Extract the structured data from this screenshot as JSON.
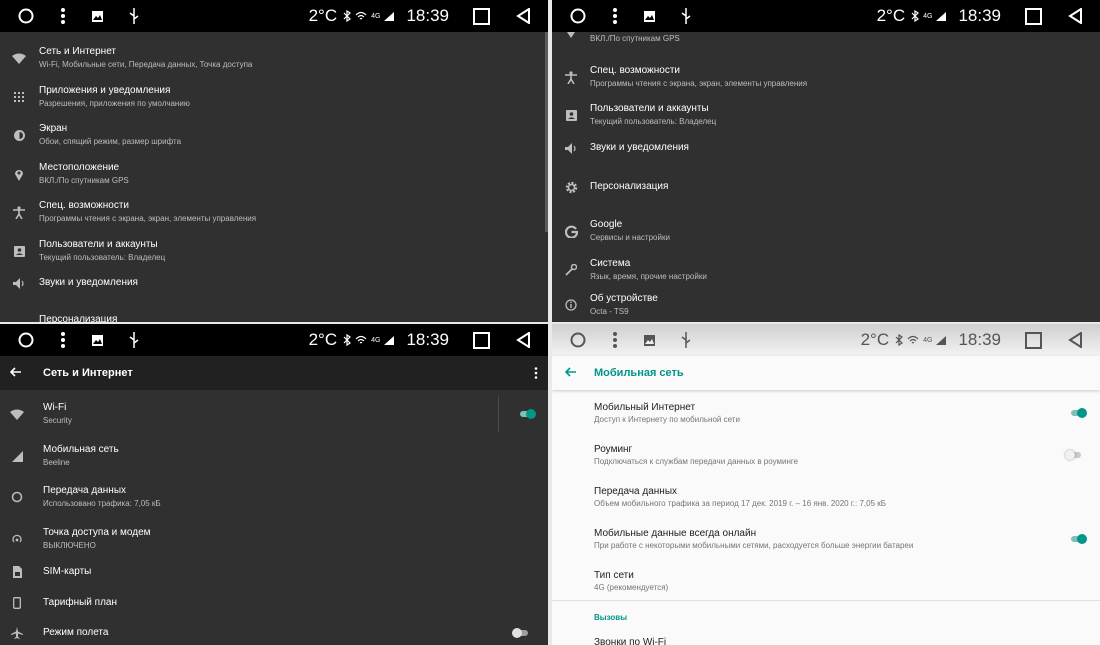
{
  "statusbar": {
    "temp": "2°C",
    "time": "18:39",
    "net": "4G"
  },
  "panel1": {
    "items": [
      {
        "title": "Сеть и Интернет",
        "subtitle": "Wi-Fi, Мобильные сети, Передача данных, Точка доступа"
      },
      {
        "title": "Приложения и уведомления",
        "subtitle": "Разрешения, приложения по умолчанию"
      },
      {
        "title": "Экран",
        "subtitle": "Обои, спящий режим, размер шрифта"
      },
      {
        "title": "Местоположение",
        "subtitle": "ВКЛ./По спутникам GPS"
      },
      {
        "title": "Спец. возможности",
        "subtitle": "Программы чтения с экрана, экран, элементы управления"
      },
      {
        "title": "Пользователи и аккаунты",
        "subtitle": "Текущий пользователь: Владелец"
      },
      {
        "title": "Звуки и уведомления",
        "subtitle": ""
      },
      {
        "title": "Персонализация",
        "subtitle": ""
      }
    ]
  },
  "panel2": {
    "items": [
      {
        "title": "",
        "subtitle": "ВКЛ./По спутникам GPS"
      },
      {
        "title": "Спец. возможности",
        "subtitle": "Программы чтения с экрана, экран, элементы управления"
      },
      {
        "title": "Пользователи и аккаунты",
        "subtitle": "Текущий пользователь: Владелец"
      },
      {
        "title": "Звуки и уведомления",
        "subtitle": ""
      },
      {
        "title": "Персонализация",
        "subtitle": ""
      },
      {
        "title": "Google",
        "subtitle": "Сервисы и настройки"
      },
      {
        "title": "Система",
        "subtitle": "Язык, время, прочие настройки"
      },
      {
        "title": "Об устройстве",
        "subtitle": "Octa - TS9"
      }
    ]
  },
  "panel3": {
    "title": "Сеть и Интернет",
    "items": [
      {
        "title": "Wi-Fi",
        "subtitle": "Security",
        "toggle": true
      },
      {
        "title": "Мобильная сеть",
        "subtitle": "Beeline"
      },
      {
        "title": "Передача данных",
        "subtitle": "Использовано трафика: 7,05 кБ"
      },
      {
        "title": "Точка доступа и модем",
        "subtitle": "ВЫКЛЮЧЕНО"
      },
      {
        "title": "SIM-карты",
        "subtitle": ""
      },
      {
        "title": "Тарифный план",
        "subtitle": ""
      },
      {
        "title": "Режим полета",
        "subtitle": "",
        "toggle": false
      }
    ]
  },
  "panel4": {
    "title": "Мобильная сеть",
    "items": [
      {
        "title": "Мобильный Интернет",
        "subtitle": "Доступ к Интернету по мобильной сети",
        "toggle": true
      },
      {
        "title": "Роуминг",
        "subtitle": "Подключаться к службам передачи данных в роуминге",
        "toggle": false
      },
      {
        "title": "Передача данных",
        "subtitle": "Объем мобильного трафика за период 17 дек. 2019 г. – 16 янв. 2020 г.: 7,05 кБ"
      },
      {
        "title": "Мобильные данные всегда онлайн",
        "subtitle": "При работе с некоторыми мобильными сетями, расходуется больше энергии батареи",
        "toggle": true
      },
      {
        "title": "Тип сети",
        "subtitle": "4G (рекомендуется)"
      }
    ],
    "section": "Вызовы",
    "last_item": "Звонки по Wi-Fi"
  },
  "colors": {
    "accent": "#009688",
    "dark_bg": "#303030",
    "toolbar_dark": "#212121"
  }
}
